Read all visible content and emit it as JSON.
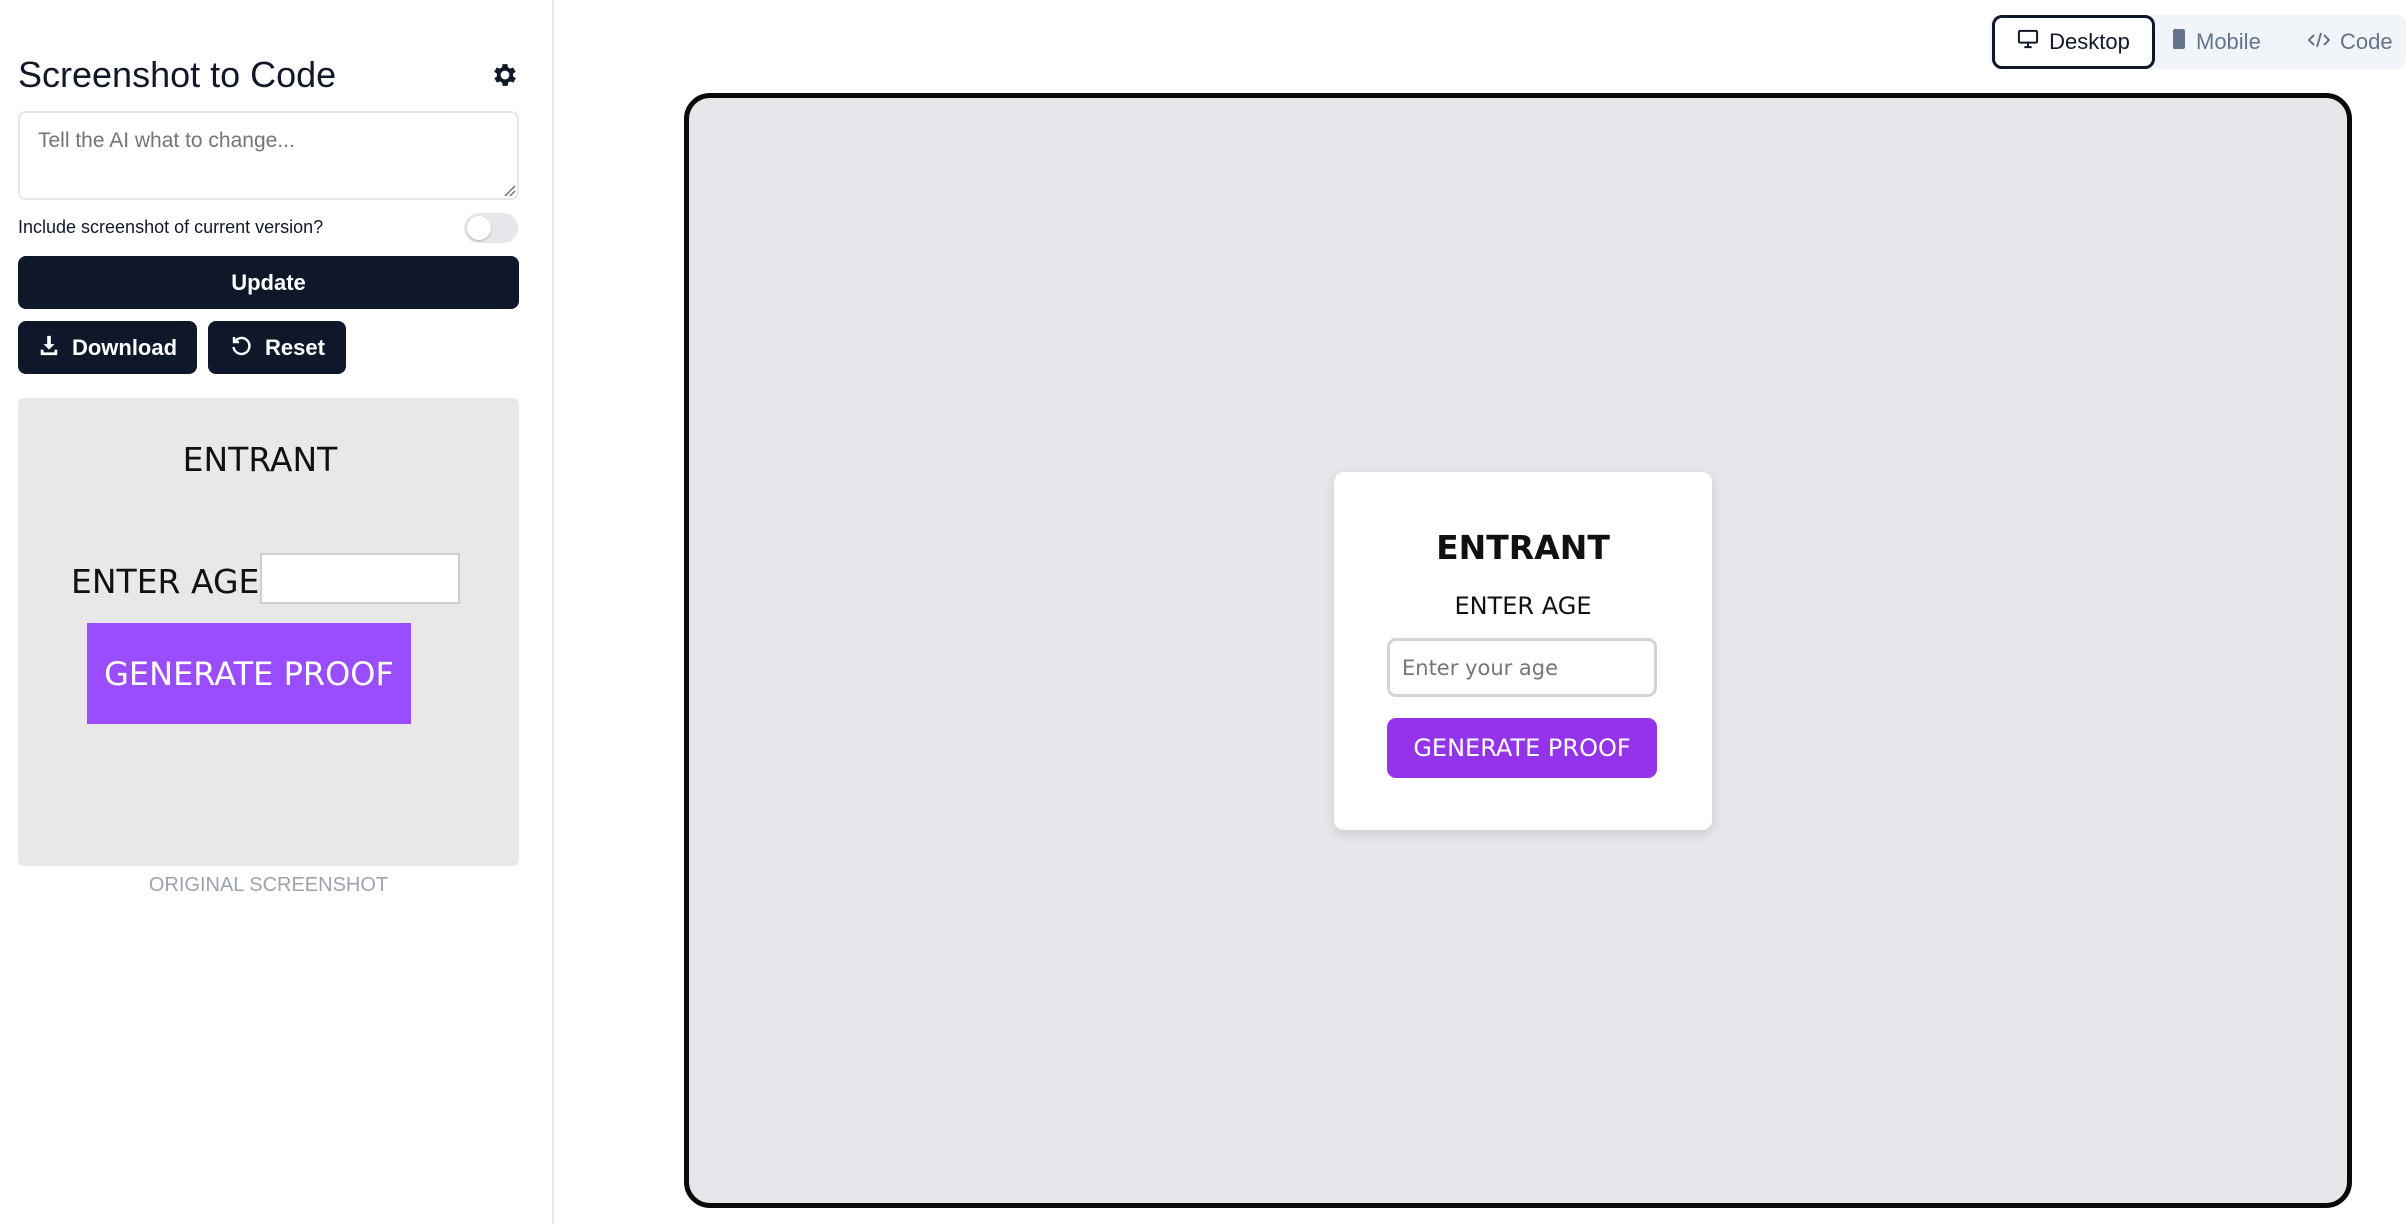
{
  "sidebar": {
    "title": "Screenshot to Code",
    "prompt_placeholder": "Tell the AI what to change...",
    "include_screenshot_label": "Include screenshot of current version?",
    "include_screenshot_enabled": false,
    "update_label": "Update",
    "download_label": "Download",
    "reset_label": "Reset",
    "original": {
      "title": "ENTRANT",
      "age_label": "ENTER AGE",
      "button_label": "GENERATE PROOF"
    },
    "original_caption": "ORIGINAL SCREENSHOT"
  },
  "view_tabs": {
    "active": "Desktop",
    "desktop_label": "Desktop",
    "mobile_label": "Mobile",
    "code_label": "Code"
  },
  "preview": {
    "title": "ENTRANT",
    "age_label": "ENTER AGE",
    "age_placeholder": "Enter your age",
    "button_label": "GENERATE PROOF"
  },
  "colors": {
    "dark_button": "#0f172a",
    "preview_button": "#9333ea",
    "original_button": "#9a4dff"
  },
  "icons": [
    "gear-icon",
    "download-icon",
    "reset-icon",
    "desktop-icon",
    "mobile-icon",
    "code-icon"
  ]
}
